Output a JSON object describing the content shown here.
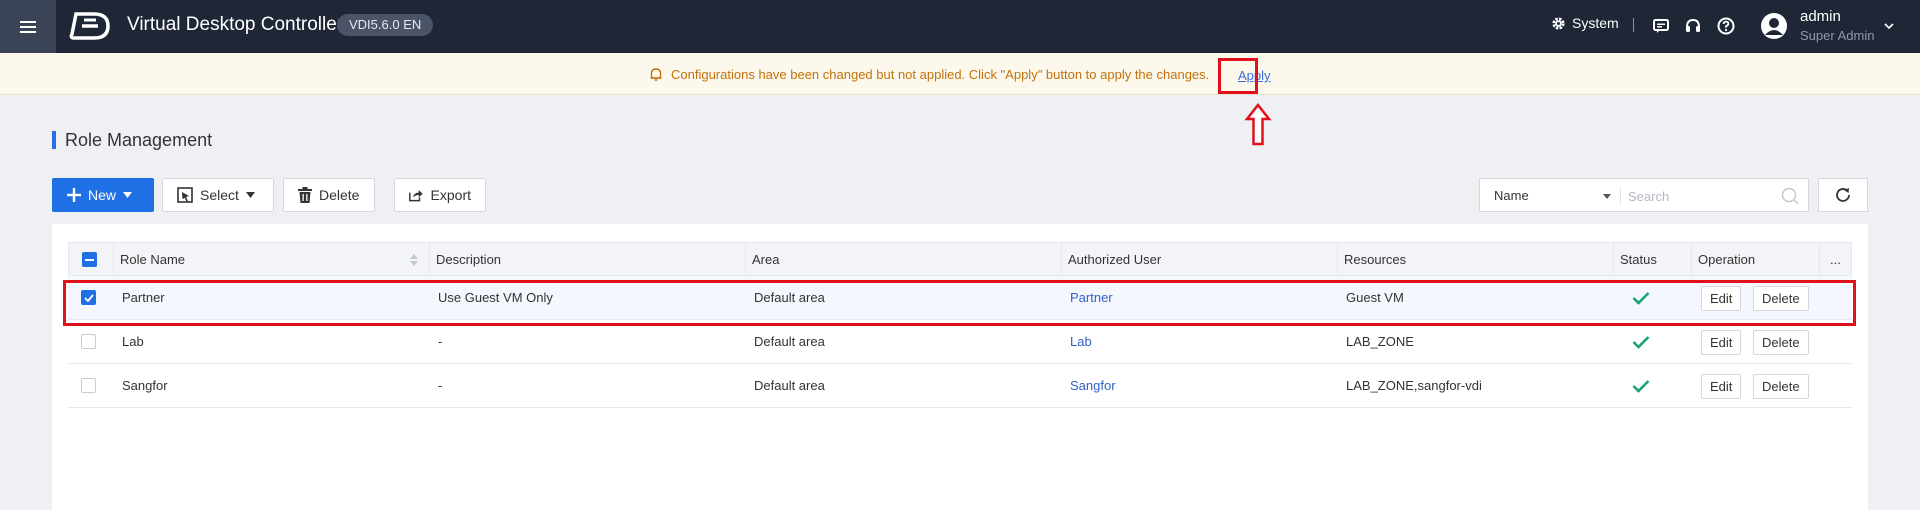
{
  "header": {
    "app_title": "Virtual Desktop Controller",
    "version": "VDI5.6.0 EN",
    "system_label": "System",
    "user": {
      "name": "admin",
      "role": "Super Admin"
    },
    "icons": [
      "menu-icon",
      "logo-icon",
      "gear-icon",
      "message-icon",
      "headset-icon",
      "help-icon",
      "user-avatar-icon",
      "chevron-down-icon"
    ]
  },
  "notice": {
    "message": "Configurations have been changed but not applied. Click \"Apply\" button to apply the changes.",
    "apply_label": "Apply",
    "color": "#c2720c"
  },
  "page": {
    "title": "Role Management"
  },
  "toolbar": {
    "new_label": "New",
    "select_label": "Select",
    "delete_label": "Delete",
    "export_label": "Export",
    "filter_field": "Name",
    "search_placeholder": "Search",
    "accent": "#1f6fe5"
  },
  "table": {
    "columns": [
      "Role Name",
      "Description",
      "Area",
      "Authorized User",
      "Resources",
      "Status",
      "Operation",
      "..."
    ],
    "rows": [
      {
        "selected": true,
        "role": "Partner",
        "description": "Use Guest VM Only",
        "area": "Default area",
        "user": "Partner",
        "resources": "Guest VM",
        "edit": "Edit",
        "delete": "Delete"
      },
      {
        "selected": false,
        "role": "Lab",
        "description": "-",
        "area": "Default area",
        "user": "Lab",
        "resources": "LAB_ZONE",
        "edit": "Edit",
        "delete": "Delete"
      },
      {
        "selected": false,
        "role": "Sangfor",
        "description": "-",
        "area": "Default area",
        "user": "Sangfor",
        "resources": "LAB_ZONE,sangfor-vdi",
        "edit": "Edit",
        "delete": "Delete"
      }
    ],
    "status_color": "#1aa36f"
  }
}
